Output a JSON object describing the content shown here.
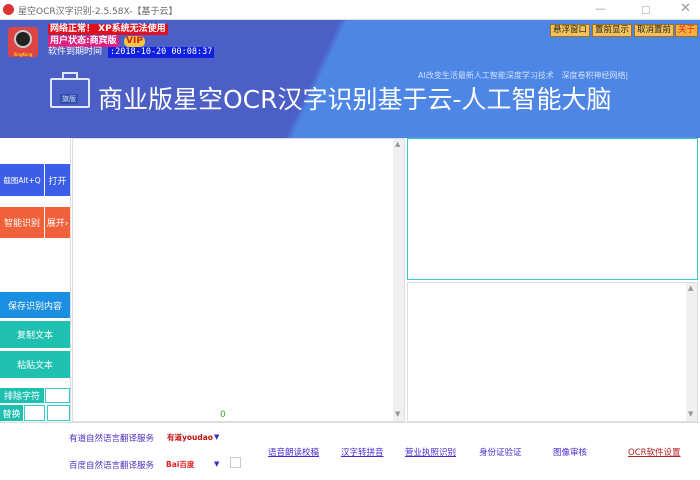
{
  "window": {
    "title": "星空OCR汉字识别-2.5.58X-【基于云】"
  },
  "status": {
    "network": "网络正常！   XP系统无法使用",
    "user_state": "用户状态:商宾版",
    "vip": "VIP",
    "expiry_label": "软件到期时间",
    "expiry_value": ":2018-10-20 00:08:37"
  },
  "logo_text": "XingKong",
  "top_buttons": [
    "悬浮窗口",
    "置前显示",
    "取消置前",
    "关于"
  ],
  "banner": {
    "slogan": "AI改变生活最新人工智能深度学习技术   深度卷积神经网络|",
    "edition_badge": "旗版",
    "title": "商业版星空OCR汉字识别基于云-人工智能大脑"
  },
  "left": {
    "capture": "截图Alt+Q",
    "open": "打开",
    "recognize": "智能识别",
    "expand": "展开›",
    "save": "保存识别内容",
    "copy": "复制文本",
    "paste": "粘贴文本",
    "exclude": "排除字符",
    "replace": "替换"
  },
  "text_area": {
    "count": "0"
  },
  "bottom": {
    "youdao": "有道自然语言翻译服务",
    "youdao_logo": "有道youdao",
    "baidu": "百度自然语言翻译服务",
    "baidu_logo": "Bai百度",
    "links": [
      "语音朗读校稿",
      "汉字转拼音",
      "营业执照识别",
      "身份证验证",
      "图像审核",
      "OCR软件设置"
    ]
  },
  "colors": {
    "banner_left": "#4b5fc7",
    "banner_right": "#4e86e6",
    "blue_btn": "#3a5ee8",
    "orange_btn": "#f0603a",
    "teal_btn": "#20c0b0"
  }
}
